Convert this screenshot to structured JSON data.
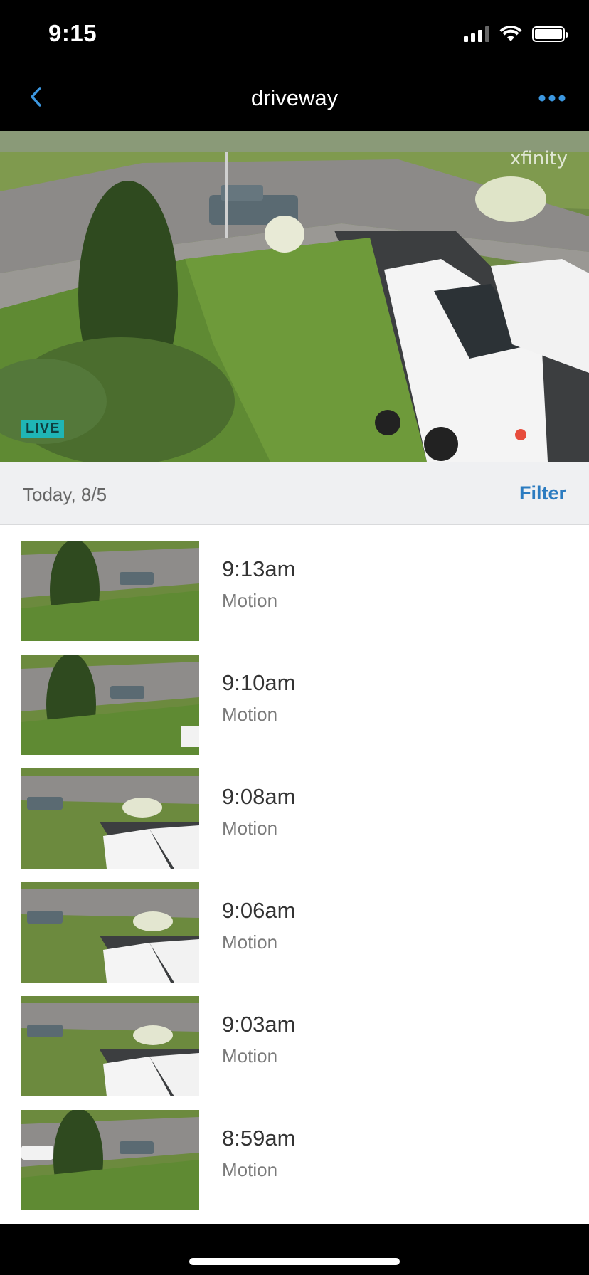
{
  "status_bar": {
    "time": "9:15"
  },
  "nav": {
    "title": "driveway",
    "back_icon": "chevron-left-icon",
    "more_icon": "ellipsis-icon"
  },
  "live_view": {
    "badge": "LIVE",
    "watermark": "xfinity"
  },
  "date_header": {
    "label": "Today, 8/5",
    "filter": "Filter"
  },
  "events": [
    {
      "time": "9:13am",
      "type": "Motion"
    },
    {
      "time": "9:10am",
      "type": "Motion"
    },
    {
      "time": "9:08am",
      "type": "Motion"
    },
    {
      "time": "9:06am",
      "type": "Motion"
    },
    {
      "time": "9:03am",
      "type": "Motion"
    },
    {
      "time": "8:59am",
      "type": "Motion"
    }
  ],
  "colors": {
    "accent": "#2b7bc0",
    "live_badge": "#1fb5b5",
    "record_dot": "#e74c3c"
  }
}
